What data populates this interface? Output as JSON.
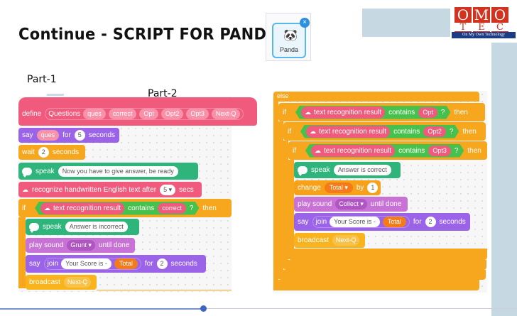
{
  "title": "Continue  - SCRIPT FOR PANDA",
  "logo": {
    "letters_top": [
      "O",
      "M",
      "O"
    ],
    "letters_bottom": [
      "T",
      "E",
      "C"
    ],
    "tagline": "On My Own Technology"
  },
  "sprite": {
    "name": "Panda",
    "panda_icon": "panda-icon",
    "close_icon": "close-icon"
  },
  "parts": {
    "part1": "Part-1",
    "part2": "Part-2"
  },
  "left_script": {
    "define": {
      "label": "define",
      "name": "Questions",
      "args": [
        "ques",
        "correct",
        "Opt",
        "Opt2",
        "Opt3",
        "Next-Q"
      ]
    },
    "say": {
      "label": "say",
      "arg": "ques",
      "for": "for",
      "secs": "5",
      "seconds": "seconds"
    },
    "wait": {
      "label": "wait",
      "secs": "2",
      "seconds": "seconds"
    },
    "speak": {
      "label": "speak",
      "text": "Now you have to give answer, be ready"
    },
    "recognize": {
      "text": "recognize handwritten English text after",
      "secs": "5 ▾",
      "unit": "secs"
    },
    "if": {
      "label": "if",
      "recog": "text recognition result",
      "contains": "contains",
      "arg": "correct",
      "q": "?",
      "then": "then"
    },
    "speak2": {
      "label": "speak",
      "text": "Answer is incorrect"
    },
    "play": {
      "label": "play sound",
      "sound": "Grunt ▾",
      "until": "until done"
    },
    "say2": {
      "label": "say",
      "join": "join",
      "text": "Your Score is -",
      "var": "Total",
      "for": "for",
      "secs": "2",
      "seconds": "seconds"
    },
    "broadcast": {
      "label": "broadcast",
      "msg": "Next-Q"
    }
  },
  "right_script": {
    "else": "else",
    "if1": {
      "label": "if",
      "recog": "text recognition result",
      "contains": "contains",
      "arg": "Opt",
      "q": "?",
      "then": "then"
    },
    "if2": {
      "label": "if",
      "recog": "text recognition result",
      "contains": "contains",
      "arg": "Opt2",
      "q": "?",
      "then": "then"
    },
    "if3": {
      "label": "if",
      "recog": "text recognition result",
      "contains": "contains",
      "arg": "Opt3",
      "q": "?",
      "then": "then"
    },
    "speak": {
      "label": "speak",
      "text": "Answer is correct"
    },
    "change": {
      "label": "change",
      "var": "Total ▾",
      "by": "by",
      "value": "1"
    },
    "play": {
      "label": "play sound",
      "sound": "Collect ▾",
      "until": "until done"
    },
    "say": {
      "label": "say",
      "join": "join",
      "text": "Your Score is -",
      "var": "Total",
      "for": "for",
      "secs": "2",
      "seconds": "seconds"
    },
    "broadcast": {
      "label": "broadcast",
      "msg": "Next-Q"
    }
  },
  "colors": {
    "pink": "#ef5a7d",
    "purple": "#9a63e8",
    "orange": "#f6a71e",
    "green": "#2fb57c",
    "sound": "#c872d6",
    "accent": "#3b66c0"
  }
}
